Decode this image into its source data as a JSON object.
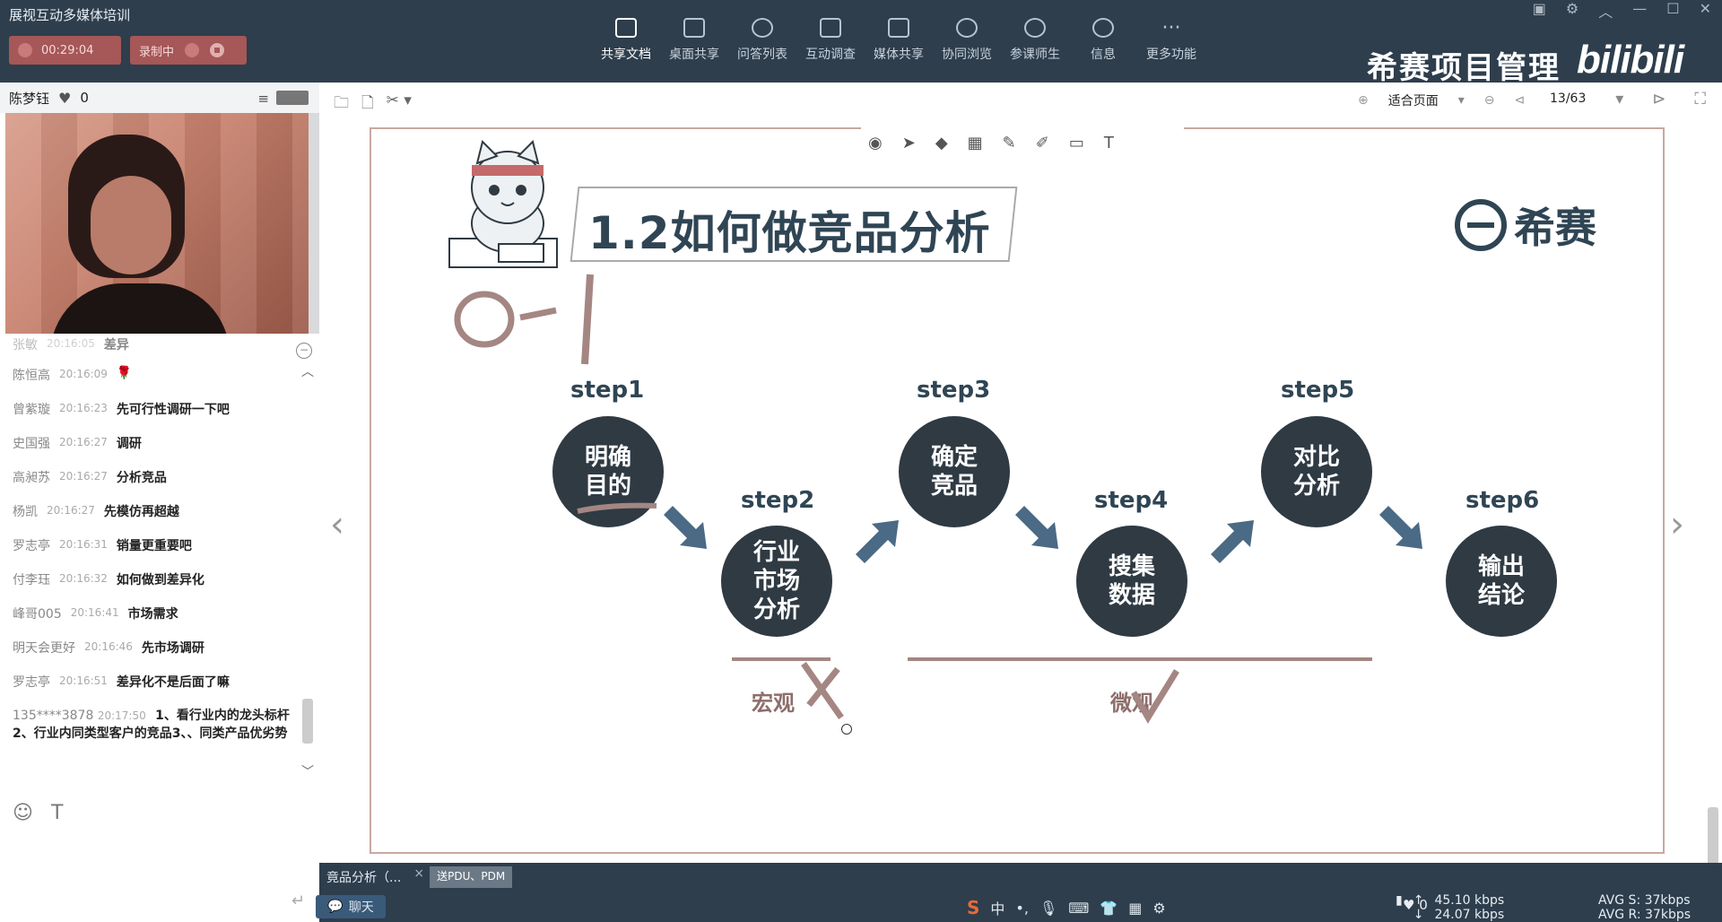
{
  "app": {
    "title": "展视互动多媒体培训",
    "timer": "00:29:04",
    "recording_label": "录制中",
    "brand_text": "希赛项目管理",
    "bili_text": "bilibili"
  },
  "toolbar": {
    "items": [
      {
        "label": "共享文档",
        "icon": "document-icon"
      },
      {
        "label": "桌面共享",
        "icon": "desktop-share-icon"
      },
      {
        "label": "问答列表",
        "icon": "qa-icon"
      },
      {
        "label": "互动调查",
        "icon": "chart-icon"
      },
      {
        "label": "媒体共享",
        "icon": "film-icon"
      },
      {
        "label": "协同浏览",
        "icon": "compass-icon"
      },
      {
        "label": "参课师生",
        "icon": "people-icon"
      },
      {
        "label": "信息",
        "icon": "info-icon"
      },
      {
        "label": "更多功能",
        "icon": "more-icon"
      }
    ]
  },
  "user": {
    "name": "陈梦钰",
    "likes": "0"
  },
  "chat": {
    "messages": [
      {
        "who": "张敏",
        "ts": "20:16:05",
        "txt": "差异"
      },
      {
        "who": "陈恒高",
        "ts": "20:16:09",
        "txt": "🌹"
      },
      {
        "who": "曾紫璇",
        "ts": "20:16:23",
        "txt": "先可行性调研一下吧"
      },
      {
        "who": "史国强",
        "ts": "20:16:27",
        "txt": "调研"
      },
      {
        "who": "高昶苏",
        "ts": "20:16:27",
        "txt": "分析竞品"
      },
      {
        "who": "杨凯",
        "ts": "20:16:27",
        "txt": "先模仿再超越"
      },
      {
        "who": "罗志亭",
        "ts": "20:16:31",
        "txt": "销量更重要吧"
      },
      {
        "who": "付李珏",
        "ts": "20:16:32",
        "txt": "如何做到差异化"
      },
      {
        "who": "峰哥005",
        "ts": "20:16:41",
        "txt": "市场需求"
      },
      {
        "who": "明天会更好",
        "ts": "20:16:46",
        "txt": "先市场调研"
      },
      {
        "who": "罗志亭",
        "ts": "20:16:51",
        "txt": "差异化不是后面了嘛"
      },
      {
        "who": "135****3878",
        "ts": "20:17:50",
        "txt": "1、看行业内的龙头标杆2、行业内同类型客户的竞品3、、同类产品优劣势"
      }
    ],
    "tab_label": "聊天"
  },
  "doc_toolbar": {
    "zoom": "适合页面",
    "page": "13/63"
  },
  "slide": {
    "title": "1.2如何做竞品分析",
    "logo_text": "希赛",
    "ink_top": "0-1",
    "steps": [
      {
        "label": "step1",
        "text": "明确\n目的"
      },
      {
        "label": "step2",
        "text": "行业\n市场\n分析"
      },
      {
        "label": "step3",
        "text": "确定\n竞品"
      },
      {
        "label": "step4",
        "text": "搜集\n数据"
      },
      {
        "label": "step5",
        "text": "对比\n分析"
      },
      {
        "label": "step6",
        "text": "输出\n结论"
      }
    ],
    "macro_label": "宏观",
    "micro_label": "微观"
  },
  "status": {
    "file_tab_1": "竟品分析（...",
    "file_tab_2": "送PDU、PDM",
    "likes": "0",
    "net_up": "45.10 kbps",
    "net_down": "24.07 kbps",
    "avg_s": "AVG S: 37kbps",
    "avg_r": "AVG R: 37kbps",
    "ime_lang": "中"
  },
  "colors": {
    "topbar": "#2e3e4d",
    "accent_red": "#a65757",
    "slide_dark": "#2f3a43",
    "arrow_blue": "#4a6a85",
    "ink": "#a48682"
  }
}
